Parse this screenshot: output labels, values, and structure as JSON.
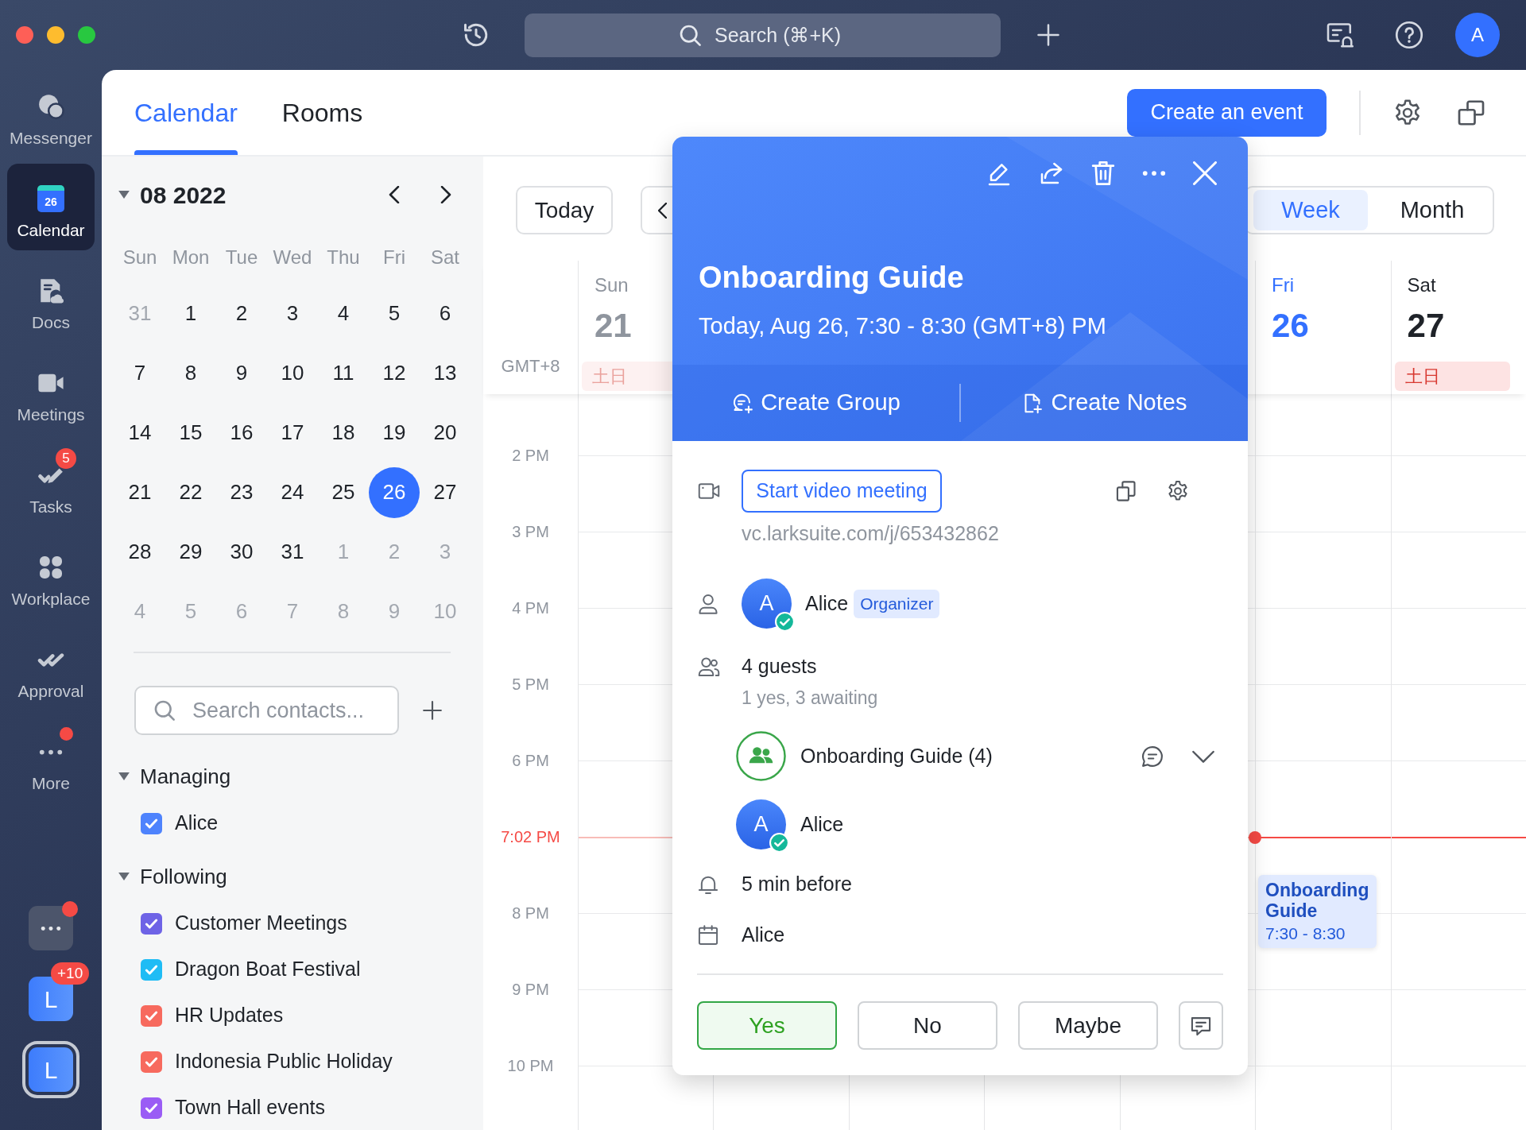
{
  "top_bar": {
    "search": {
      "placeholder": "Search (⌘+K)"
    },
    "avatar": "A"
  },
  "nav": {
    "items": [
      {
        "label": "Messenger",
        "selected": false,
        "dot": false
      },
      {
        "label": "Calendar",
        "selected": true,
        "dot": false,
        "icon_text": "26"
      },
      {
        "label": "Docs",
        "selected": false,
        "dot": false
      },
      {
        "label": "Meetings",
        "selected": false,
        "dot": false
      },
      {
        "label": "Tasks",
        "selected": false,
        "dot": false,
        "badge": "5"
      },
      {
        "label": "Workplace",
        "selected": false,
        "dot": false
      },
      {
        "label": "Approval",
        "selected": false,
        "dot": false
      },
      {
        "label": "More",
        "selected": false,
        "dot": true
      }
    ],
    "dock": [
      {
        "kind": "apps",
        "selected": false,
        "dot": true
      },
      {
        "kind": "workspace",
        "letter": "L",
        "badge": "+10",
        "selected": false
      },
      {
        "kind": "workspace",
        "letter": "L",
        "selected": true
      }
    ]
  },
  "tabs": [
    {
      "label": "Calendar",
      "selected": true
    },
    {
      "label": "Rooms",
      "selected": false
    }
  ],
  "create_button": "Create an event",
  "mini_calendar": {
    "title": "08 2022",
    "weekdays": [
      "Sun",
      "Mon",
      "Tue",
      "Wed",
      "Thu",
      "Fri",
      "Sat"
    ],
    "weeks": [
      [
        {
          "day": "31",
          "muted": true,
          "selected": false
        },
        {
          "day": "1",
          "muted": false,
          "selected": false
        },
        {
          "day": "2",
          "muted": false,
          "selected": false
        },
        {
          "day": "3",
          "muted": false,
          "selected": false
        },
        {
          "day": "4",
          "muted": false,
          "selected": false
        },
        {
          "day": "5",
          "muted": false,
          "selected": false
        },
        {
          "day": "6",
          "muted": false,
          "selected": false
        }
      ],
      [
        {
          "day": "7",
          "muted": false,
          "selected": false
        },
        {
          "day": "8",
          "muted": false,
          "selected": false
        },
        {
          "day": "9",
          "muted": false,
          "selected": false
        },
        {
          "day": "10",
          "muted": false,
          "selected": false
        },
        {
          "day": "11",
          "muted": false,
          "selected": false
        },
        {
          "day": "12",
          "muted": false,
          "selected": false
        },
        {
          "day": "13",
          "muted": false,
          "selected": false
        }
      ],
      [
        {
          "day": "14",
          "muted": false,
          "selected": false
        },
        {
          "day": "15",
          "muted": false,
          "selected": false
        },
        {
          "day": "16",
          "muted": false,
          "selected": false
        },
        {
          "day": "17",
          "muted": false,
          "selected": false
        },
        {
          "day": "18",
          "muted": false,
          "selected": false
        },
        {
          "day": "19",
          "muted": false,
          "selected": false
        },
        {
          "day": "20",
          "muted": false,
          "selected": false
        }
      ],
      [
        {
          "day": "21",
          "muted": false,
          "selected": false
        },
        {
          "day": "22",
          "muted": false,
          "selected": false
        },
        {
          "day": "23",
          "muted": false,
          "selected": false
        },
        {
          "day": "24",
          "muted": false,
          "selected": false
        },
        {
          "day": "25",
          "muted": false,
          "selected": false
        },
        {
          "day": "26",
          "muted": false,
          "selected": true
        },
        {
          "day": "27",
          "muted": false,
          "selected": false
        }
      ],
      [
        {
          "day": "28",
          "muted": false,
          "selected": false
        },
        {
          "day": "29",
          "muted": false,
          "selected": false
        },
        {
          "day": "30",
          "muted": false,
          "selected": false
        },
        {
          "day": "31",
          "muted": false,
          "selected": false
        },
        {
          "day": "1",
          "muted": true,
          "selected": false
        },
        {
          "day": "2",
          "muted": true,
          "selected": false
        },
        {
          "day": "3",
          "muted": true,
          "selected": false
        }
      ],
      [
        {
          "day": "4",
          "muted": true,
          "selected": false
        },
        {
          "day": "5",
          "muted": true,
          "selected": false
        },
        {
          "day": "6",
          "muted": true,
          "selected": false
        },
        {
          "day": "7",
          "muted": true,
          "selected": false
        },
        {
          "day": "8",
          "muted": true,
          "selected": false
        },
        {
          "day": "9",
          "muted": true,
          "selected": false
        },
        {
          "day": "10",
          "muted": true,
          "selected": false
        }
      ]
    ]
  },
  "contact_search": {
    "placeholder": "Search contacts..."
  },
  "calendar_groups": [
    {
      "label": "Managing",
      "expanded": true,
      "items": [
        {
          "label": "Alice",
          "checked": true,
          "color": "#4e83fd"
        }
      ]
    },
    {
      "label": "Following",
      "expanded": true,
      "items": [
        {
          "label": "Customer Meetings",
          "checked": true,
          "color": "#6e63e6"
        },
        {
          "label": "Dragon Boat Festival",
          "checked": true,
          "color": "#1fbcf5"
        },
        {
          "label": "HR Updates",
          "checked": true,
          "color": "#f76a5e"
        },
        {
          "label": "Indonesia Public Holiday",
          "checked": true,
          "color": "#f76a5e"
        },
        {
          "label": "Town Hall events",
          "checked": true,
          "color": "#9a5cf5"
        }
      ]
    }
  ],
  "toolbar": {
    "today_button": "Today",
    "views": [
      {
        "label": "Week",
        "selected": true
      },
      {
        "label": "Month",
        "selected": false
      }
    ]
  },
  "week_view": {
    "timezone": "GMT+8",
    "days": [
      {
        "weekday": "Sun",
        "date": "21",
        "holiday": "土日",
        "past": true,
        "today": false
      },
      {
        "weekday": "Fri",
        "date": "26",
        "past": false,
        "today": true,
        "events": [
          {
            "title": "Onboarding Guide",
            "time": "7:30 - 8:30"
          }
        ]
      },
      {
        "weekday": "Sat",
        "date": "27",
        "holiday": "土日",
        "past": false,
        "today": false
      }
    ],
    "hours": [
      {
        "label": "2 PM",
        "current": false
      },
      {
        "label": "3 PM",
        "current": false
      },
      {
        "label": "4 PM",
        "current": false
      },
      {
        "label": "5 PM",
        "current": false
      },
      {
        "label": "6 PM",
        "current": false
      },
      {
        "label": "7:02 PM",
        "current": true
      },
      {
        "label": "8 PM",
        "current": false
      },
      {
        "label": "9 PM",
        "current": false
      },
      {
        "label": "10 PM",
        "current": false
      }
    ]
  },
  "event_popover": {
    "title": "Onboarding Guide",
    "time": "Today, Aug 26, 7:30 - 8:30 (GMT+8) PM",
    "actions": [
      "Create Group",
      "Create Notes"
    ],
    "video": {
      "button": "Start video meeting",
      "link": "vc.larksuite.com/j/653432862"
    },
    "organizer": {
      "avatar": "A",
      "name": "Alice",
      "tag": "Organizer",
      "accepted": true
    },
    "guests": {
      "count": "4 guests",
      "summary": "1 yes, 3 awaiting",
      "list": [
        {
          "kind": "group",
          "name": "Onboarding Guide (4)"
        },
        {
          "kind": "person",
          "avatar": "A",
          "name": "Alice",
          "accepted": true
        }
      ]
    },
    "reminder": "5 min before",
    "calendar": "Alice",
    "rsvp": [
      {
        "label": "Yes",
        "selected": true
      },
      {
        "label": "No",
        "selected": false
      },
      {
        "label": "Maybe",
        "selected": false
      }
    ]
  }
}
